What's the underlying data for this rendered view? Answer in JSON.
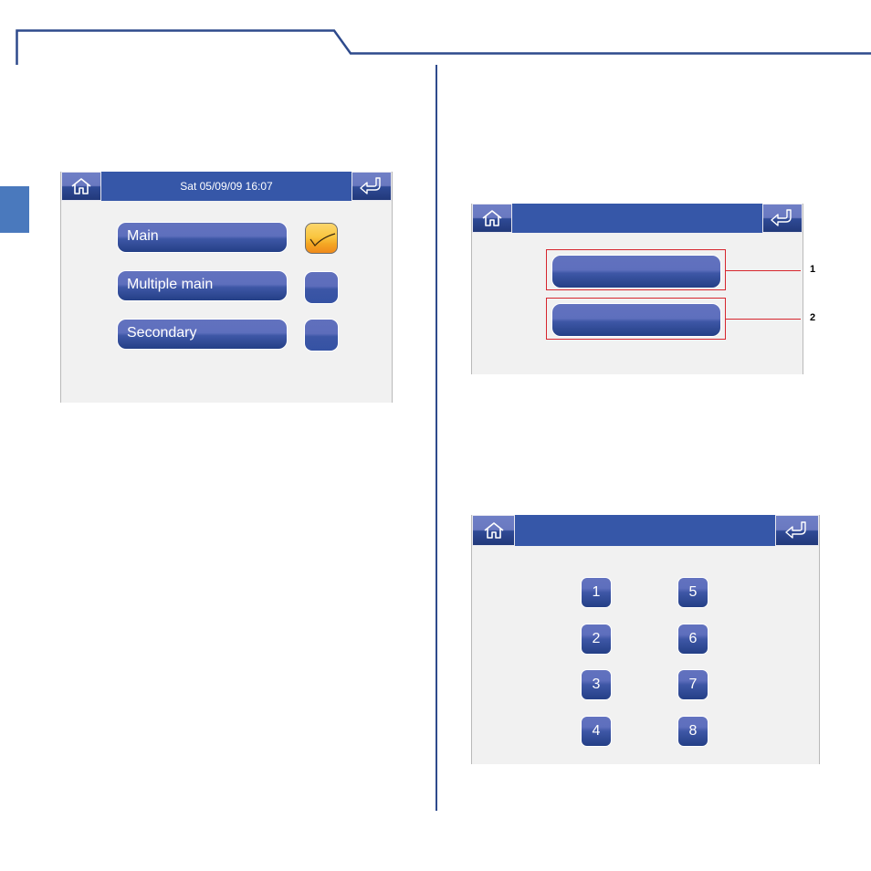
{
  "page": {
    "accent_color": "#2e4a8c",
    "side_tab_color": "#4a79bd"
  },
  "screen_select_unit": {
    "titlebar": {
      "title": "Sat 05/09/09 16:07",
      "home_icon": "home-icon",
      "back_icon": "return-arrow-icon"
    },
    "options": [
      {
        "label": "Main",
        "checked": true
      },
      {
        "label": "Multiple main",
        "checked": false
      },
      {
        "label": "Secondary",
        "checked": false
      }
    ]
  },
  "screen_two_buttons": {
    "titlebar": {
      "title": "",
      "home_icon": "home-icon",
      "back_icon": "return-arrow-icon"
    },
    "buttons": [
      {
        "label": "",
        "callout": "1"
      },
      {
        "label": "",
        "callout": "2"
      }
    ],
    "callout_color": "#d6262e"
  },
  "screen_keypad": {
    "titlebar": {
      "title": "",
      "home_icon": "home-icon",
      "back_icon": "return-arrow-icon"
    },
    "keys_left": [
      "1",
      "2",
      "3",
      "4"
    ],
    "keys_right": [
      "5",
      "6",
      "7",
      "8"
    ]
  }
}
